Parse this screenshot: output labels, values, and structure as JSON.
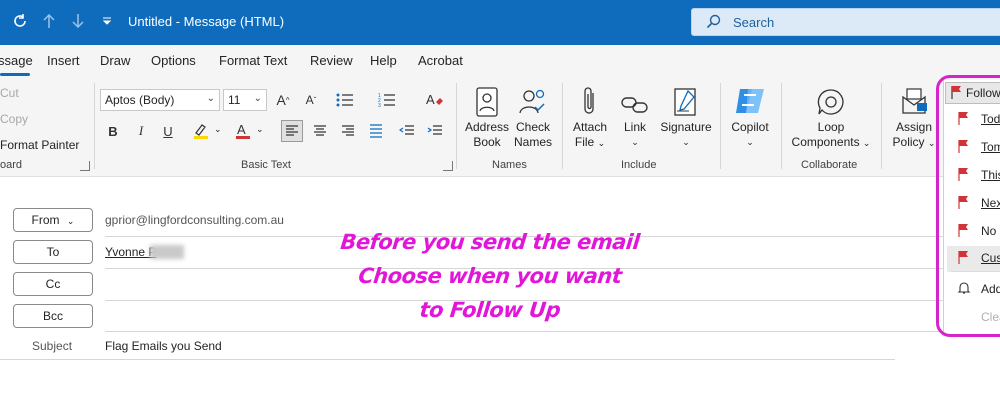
{
  "window": {
    "title": "Untitled  -  Message (HTML)",
    "search_placeholder": "Search",
    "accent": "#0f6cbd"
  },
  "tabs": [
    "ssage",
    "Insert",
    "Draw",
    "Options",
    "Format Text",
    "Review",
    "Help",
    "Acrobat"
  ],
  "ribbon": {
    "clipboard": {
      "cut": "Cut",
      "copy": "Copy",
      "format_painter": "Format Painter",
      "label": "oard"
    },
    "basic_text": {
      "font": "Aptos (Body)",
      "size": "11",
      "label": "Basic Text"
    },
    "names": {
      "address_book": [
        "Address",
        "Book"
      ],
      "check_names": [
        "Check",
        "Names"
      ],
      "label": "Names"
    },
    "include": {
      "attach": [
        "Attach",
        "File"
      ],
      "link": "Link",
      "signature": "Signature",
      "label": "Include"
    },
    "copilot": {
      "label": "Copilot"
    },
    "collaborate": {
      "loop": [
        "Loop",
        "Components"
      ],
      "label": "Collaborate"
    },
    "assign_policy": [
      "Assign",
      "Policy"
    ]
  },
  "followup": {
    "button_label": "Follow",
    "items": [
      "Tod",
      "Tom",
      "This",
      "Nex",
      "No",
      "Cus",
      "Add",
      "Clea"
    ],
    "flag_color": "#d13438",
    "highlight_color": "#d624c8"
  },
  "compose": {
    "from_label": "From",
    "from_value": "gprior@lingfordconsulting.com.au",
    "to_label": "To",
    "to_value": "Yvonne P",
    "cc_label": "Cc",
    "bcc_label": "Bcc",
    "subject_label": "Subject",
    "subject_value": "Flag Emails you Send"
  },
  "annotation": {
    "line1": "Before you send the email",
    "line2": "Choose when you want",
    "line3": "to Follow Up",
    "color": "#e216d8"
  }
}
